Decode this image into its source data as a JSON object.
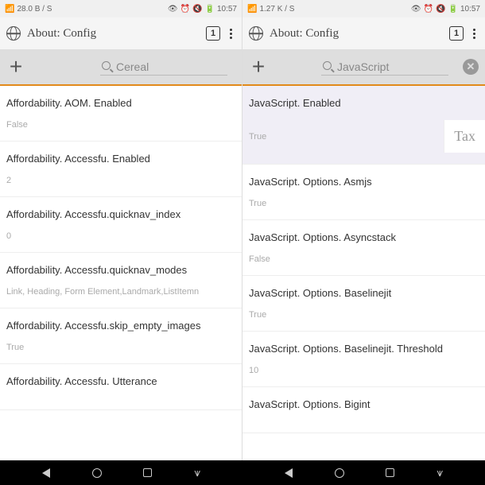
{
  "statusbar": {
    "left_speed_a": "28.0 B / S",
    "left_speed_b": "1.27 K / S",
    "time": "10:57"
  },
  "titlebar": {
    "title": "About: Config",
    "tabcount": "1"
  },
  "search": {
    "left_value": "Cereal",
    "right_value": "JavaScript"
  },
  "left_rows": [
    {
      "title": "Affordability. AOM. Enabled",
      "value": "False"
    },
    {
      "title": "Affordability. Accessfu. Enabled",
      "value": "2"
    },
    {
      "title": "Affordability. Accessfu.quicknav_index",
      "value": "0"
    },
    {
      "title": "Affordability. Accessfu.quicknav_modes",
      "value": "Link, Heading, Form Element,Landmark,ListItemn"
    },
    {
      "title": "Affordability. Accessfu.skip_empty_images",
      "value": "True"
    },
    {
      "title": "Affordability. Accessfu. Utterance",
      "value": ""
    }
  ],
  "right_rows": [
    {
      "title": "JavaScript. Enabled",
      "value": "True",
      "hl": true,
      "tax": "Tax"
    },
    {
      "title": "JavaScript. Options. Asmjs",
      "value": "True"
    },
    {
      "title": "JavaScript. Options. Asyncstack",
      "value": "False"
    },
    {
      "title": "JavaScript. Options. Baselinejit",
      "value": "True"
    },
    {
      "title": "JavaScript. Options. Baselinejit. Threshold",
      "value": "10"
    },
    {
      "title": "JavaScript. Options. Bigint",
      "value": ""
    }
  ]
}
